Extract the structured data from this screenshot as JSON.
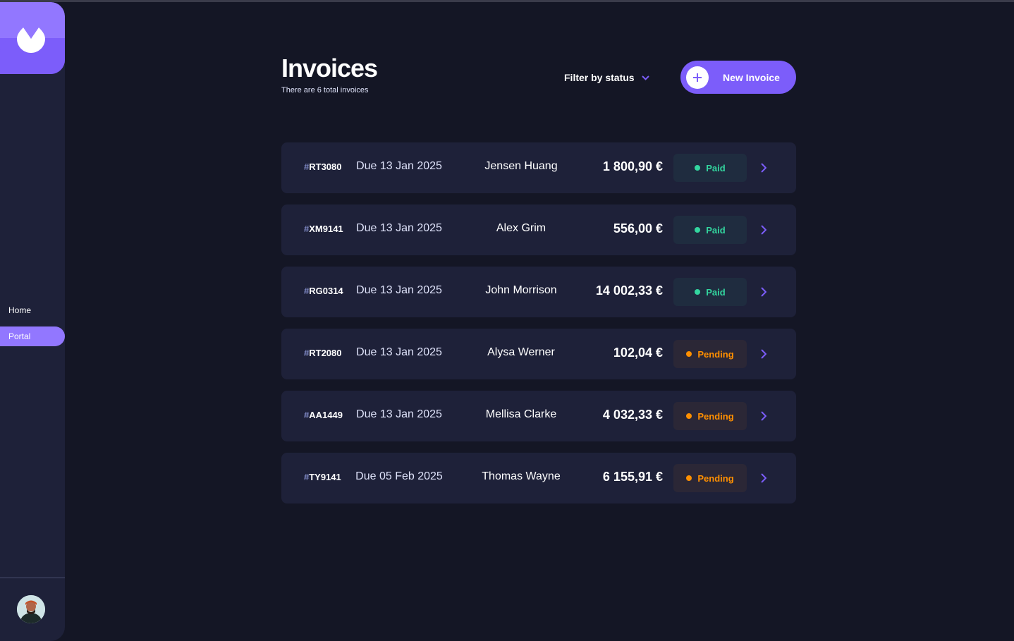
{
  "sidebar": {
    "logo": "brand-logo",
    "nav": [
      {
        "label": "Home"
      },
      {
        "label": "Portal"
      }
    ],
    "avatar": "user-avatar"
  },
  "header": {
    "title": "Invoices",
    "subtitle": "There are 6 total invoices",
    "filter_label": "Filter by status",
    "new_invoice_label": "New Invoice"
  },
  "colors": {
    "accent": "#7c5dfa",
    "accent_light": "#9277ff",
    "background": "#141625",
    "card": "#1e2139",
    "paid": "#33d69f",
    "pending": "#ff8f00"
  },
  "invoices": [
    {
      "hash": "#",
      "id": "RT3080",
      "due": "Due 13 Jan 2025",
      "client": "Jensen Huang",
      "amount": "1 800,90 €",
      "status": "Paid"
    },
    {
      "hash": "#",
      "id": "XM9141",
      "due": "Due 13 Jan 2025",
      "client": "Alex Grim",
      "amount": "556,00 €",
      "status": "Paid"
    },
    {
      "hash": "#",
      "id": "RG0314",
      "due": "Due 13 Jan 2025",
      "client": "John Morrison",
      "amount": "14 002,33 €",
      "status": "Paid"
    },
    {
      "hash": "#",
      "id": "RT2080",
      "due": "Due 13 Jan 2025",
      "client": "Alysa Werner",
      "amount": "102,04 €",
      "status": "Pending"
    },
    {
      "hash": "#",
      "id": "AA1449",
      "due": "Due 13 Jan 2025",
      "client": "Mellisa Clarke",
      "amount": "4 032,33 €",
      "status": "Pending"
    },
    {
      "hash": "#",
      "id": "TY9141",
      "due": "Due 05 Feb 2025",
      "client": "Thomas Wayne",
      "amount": "6 155,91 €",
      "status": "Pending"
    }
  ]
}
